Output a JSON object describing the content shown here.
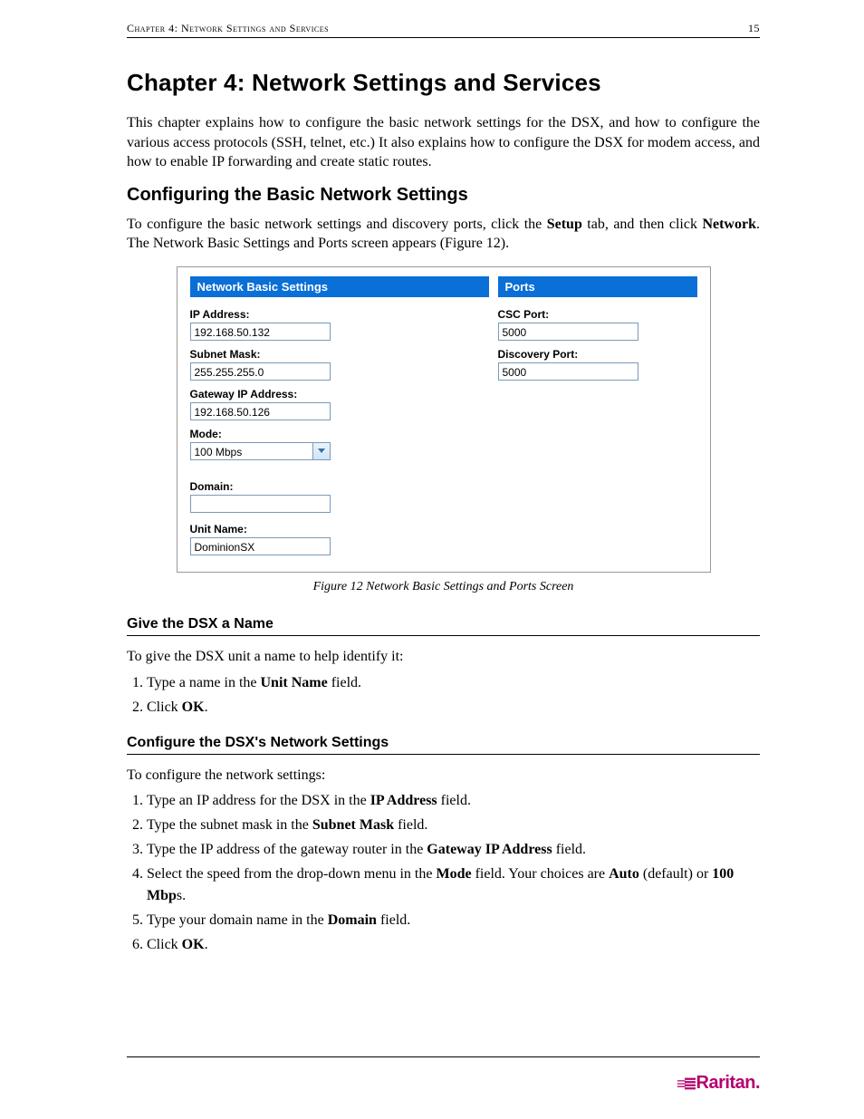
{
  "header": {
    "left": "Chapter 4: Network Settings and Services",
    "page": "15"
  },
  "h1": "Chapter 4: Network Settings and Services",
  "intro": "This chapter explains how to configure the basic network settings for the DSX, and how to configure the various access protocols (SSH, telnet, etc.) It also explains how to configure the DSX for modem access, and how to enable IP forwarding and create static routes.",
  "h2": "Configuring the Basic Network Settings",
  "p2a": "To configure the basic network settings and discovery ports, click the ",
  "p2b": "Setup",
  "p2c": " tab, and then click ",
  "p2d": "Network",
  "p2e": ". The Network Basic Settings and Ports screen appears (Figure 12).",
  "panel": {
    "leftTitle": "Network Basic Settings",
    "rightTitle": "Ports",
    "ip_lbl": "IP Address:",
    "ip_val": "192.168.50.132",
    "sm_lbl": "Subnet Mask:",
    "sm_val": "255.255.255.0",
    "gw_lbl": "Gateway IP Address:",
    "gw_val": "192.168.50.126",
    "mode_lbl": "Mode:",
    "mode_val": "100 Mbps",
    "dom_lbl": "Domain:",
    "dom_val": "",
    "unit_lbl": "Unit Name:",
    "unit_val": "DominionSX",
    "csc_lbl": "CSC Port:",
    "csc_val": "5000",
    "disc_lbl": "Discovery Port:",
    "disc_val": "5000"
  },
  "caption": "Figure 12 Network Basic Settings and Ports Screen",
  "h3a": "Give the DSX a Name",
  "p3": "To give the DSX unit a name to help identify it:",
  "s1": {
    "a": "Type a name in the ",
    "b": "Unit Name",
    "c": " field.",
    "d": "Click ",
    "e": "OK",
    "f": "."
  },
  "h3b": "Configure the DSX's Network Settings",
  "p4": "To configure the network settings:",
  "s2": {
    "l1a": "Type an IP address for the DSX in the ",
    "l1b": "IP Address",
    "l1c": " field.",
    "l2a": "Type the subnet mask in the ",
    "l2b": "Subnet Mask",
    "l2c": " field.",
    "l3a": "Type the IP address of the gateway router in the ",
    "l3b": "Gateway IP Address",
    "l3c": " field.",
    "l4a": "Select the speed from the drop-down menu in the ",
    "l4b": "Mode",
    "l4c": " field. Your choices are ",
    "l4d": "Auto",
    "l4e": " (default) or ",
    "l4f": "100 Mbp",
    "l4g": "s.",
    "l5a": "Type your domain name in the ",
    "l5b": "Domain",
    "l5c": " field.",
    "l6a": "Click ",
    "l6b": "OK",
    "l6c": "."
  },
  "logo": "Raritan."
}
